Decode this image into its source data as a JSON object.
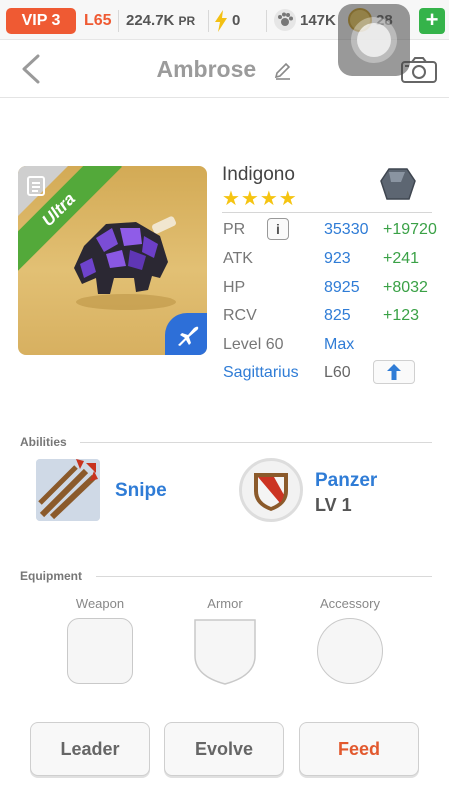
{
  "topbar": {
    "vip": "VIP 3",
    "level": "L65",
    "power": "224.7K",
    "power_unit": "PR",
    "energy": "0",
    "paws": "147K",
    "coins": "28",
    "add": "+"
  },
  "header": {
    "title": "Ambrose"
  },
  "monster": {
    "rarity": "Ultra",
    "name": "Indigono",
    "stars": "★★★★",
    "stats": [
      {
        "label": "PR",
        "value": "35330",
        "bonus": "+19720"
      },
      {
        "label": "ATK",
        "value": "923",
        "bonus": "+241"
      },
      {
        "label": "HP",
        "value": "8925",
        "bonus": "+8032"
      },
      {
        "label": "RCV",
        "value": "825",
        "bonus": "+123"
      }
    ],
    "info": "i",
    "level_label": "Level 60",
    "level_value": "Max",
    "sign": "Sagittarius",
    "sign_level": "L60"
  },
  "abilities": {
    "title": "Abilities",
    "skill_name": "Snipe",
    "passive_name": "Panzer",
    "passive_level": "LV 1"
  },
  "equipment": {
    "title": "Equipment",
    "weapon": "Weapon",
    "armor": "Armor",
    "accessory": "Accessory"
  },
  "buttons": {
    "leader": "Leader",
    "evolve": "Evolve",
    "feed": "Feed"
  },
  "colors": {
    "vip": "#ef5a33",
    "stat_value": "#2f7cd6",
    "stat_bonus": "#3aa146",
    "rarity_ribbon": "#53a93a",
    "feed": "#e2592e"
  }
}
